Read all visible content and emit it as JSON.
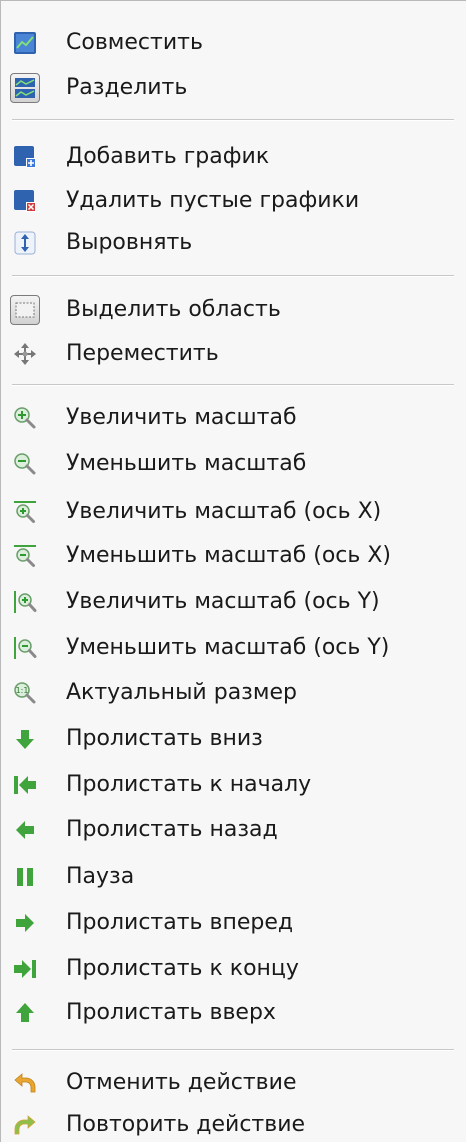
{
  "menu": {
    "items": [
      {
        "label": "Совместить",
        "icon": "combine-charts-icon"
      },
      {
        "label": "Разделить",
        "icon": "split-charts-icon"
      },
      {
        "label": "Добавить график",
        "icon": "add-chart-icon"
      },
      {
        "label": "Удалить пустые графики",
        "icon": "remove-empty-charts-icon"
      },
      {
        "label": "Выровнять",
        "icon": "align-vertical-icon"
      },
      {
        "label": "Выделить область",
        "icon": "select-area-icon"
      },
      {
        "label": "Переместить",
        "icon": "move-icon"
      },
      {
        "label": "Увеличить масштаб",
        "icon": "zoom-in-icon"
      },
      {
        "label": "Уменьшить масштаб",
        "icon": "zoom-out-icon"
      },
      {
        "label": "Увеличить масштаб (ось X)",
        "icon": "zoom-in-x-icon"
      },
      {
        "label": "Уменьшить масштаб (ось X)",
        "icon": "zoom-out-x-icon"
      },
      {
        "label": "Увеличить масштаб (ось Y)",
        "icon": "zoom-in-y-icon"
      },
      {
        "label": "Уменьшить масштаб (ось Y)",
        "icon": "zoom-out-y-icon"
      },
      {
        "label": "Актуальный размер",
        "icon": "zoom-actual-size-icon"
      },
      {
        "label": "Пролистать вниз",
        "icon": "arrow-down-icon"
      },
      {
        "label": "Пролистать к началу",
        "icon": "go-first-icon"
      },
      {
        "label": "Пролистать назад",
        "icon": "arrow-left-icon"
      },
      {
        "label": "Пауза",
        "icon": "pause-icon"
      },
      {
        "label": "Пролистать вперед",
        "icon": "arrow-right-icon"
      },
      {
        "label": "Пролистать к концу",
        "icon": "go-last-icon"
      },
      {
        "label": "Пролистать вверх",
        "icon": "arrow-up-icon"
      },
      {
        "label": "Отменить действие",
        "icon": "undo-icon"
      },
      {
        "label": "Повторить действие",
        "icon": "redo-icon"
      }
    ]
  },
  "colors": {
    "menu_background": "#f7f7f7",
    "separator": "#c8c8c8",
    "icon_blue": "#2f63b0",
    "icon_green": "#3ea43b",
    "icon_orange": "#e0a020"
  }
}
